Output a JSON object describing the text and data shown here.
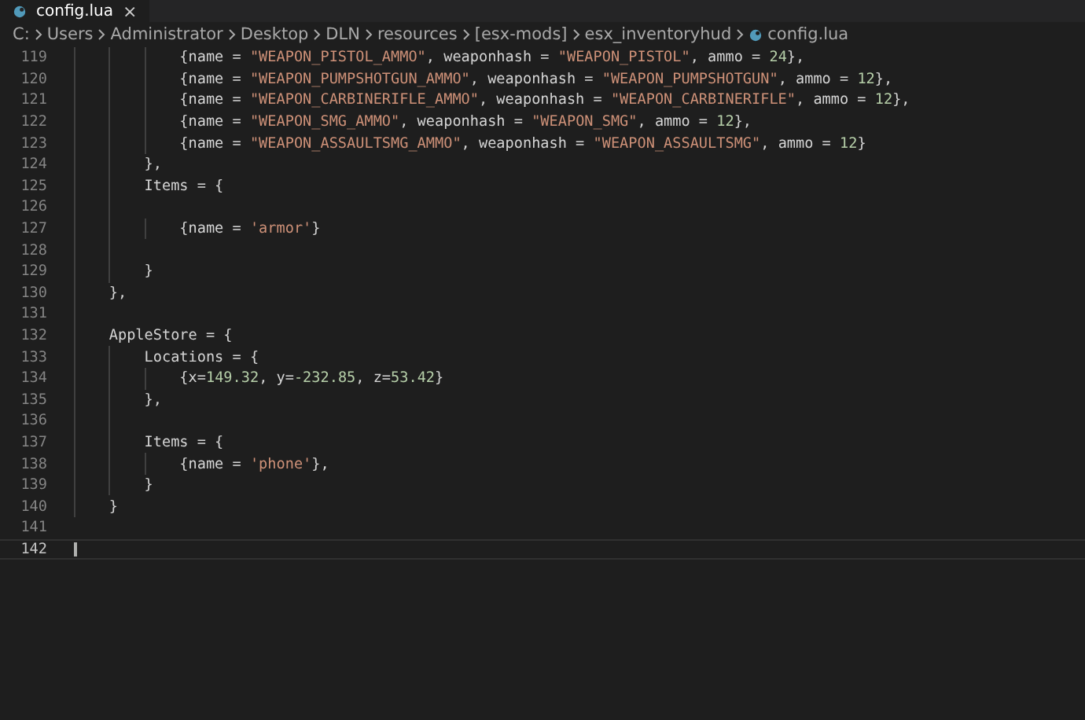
{
  "tab": {
    "title": "config.lua",
    "close": "×",
    "selected": true
  },
  "breadcrumb": [
    {
      "label": "C:",
      "kind": "folder"
    },
    {
      "label": "Users",
      "kind": "folder"
    },
    {
      "label": "Administrator",
      "kind": "folder"
    },
    {
      "label": "Desktop",
      "kind": "folder"
    },
    {
      "label": "DLN",
      "kind": "folder"
    },
    {
      "label": "resources",
      "kind": "folder"
    },
    {
      "label": "[esx-mods]",
      "kind": "folder"
    },
    {
      "label": "esx_inventoryhud",
      "kind": "folder"
    },
    {
      "label": "config.lua",
      "kind": "file"
    }
  ],
  "editor": {
    "lines": [
      {
        "number": "119",
        "active": false,
        "tokens": [
          {
            "kind": "plain",
            "text": "            {name = "
          },
          {
            "kind": "string",
            "text": "\"WEAPON_PISTOL_AMMO\""
          },
          {
            "kind": "plain",
            "text": ", weaponhash = "
          },
          {
            "kind": "string",
            "text": "\"WEAPON_PISTOL\""
          },
          {
            "kind": "plain",
            "text": ", ammo = "
          },
          {
            "kind": "number",
            "text": "24"
          },
          {
            "kind": "plain",
            "text": "},"
          }
        ]
      },
      {
        "number": "120",
        "active": false,
        "tokens": [
          {
            "kind": "plain",
            "text": "            {name = "
          },
          {
            "kind": "string",
            "text": "\"WEAPON_PUMPSHOTGUN_AMMO\""
          },
          {
            "kind": "plain",
            "text": ", weaponhash = "
          },
          {
            "kind": "string",
            "text": "\"WEAPON_PUMPSHOTGUN\""
          },
          {
            "kind": "plain",
            "text": ", ammo = "
          },
          {
            "kind": "number",
            "text": "12"
          },
          {
            "kind": "plain",
            "text": "},"
          }
        ]
      },
      {
        "number": "121",
        "active": false,
        "tokens": [
          {
            "kind": "plain",
            "text": "            {name = "
          },
          {
            "kind": "string",
            "text": "\"WEAPON_CARBINERIFLE_AMMO\""
          },
          {
            "kind": "plain",
            "text": ", weaponhash = "
          },
          {
            "kind": "string",
            "text": "\"WEAPON_CARBINERIFLE\""
          },
          {
            "kind": "plain",
            "text": ", ammo = "
          },
          {
            "kind": "number",
            "text": "12"
          },
          {
            "kind": "plain",
            "text": "},"
          }
        ]
      },
      {
        "number": "122",
        "active": false,
        "tokens": [
          {
            "kind": "plain",
            "text": "            {name = "
          },
          {
            "kind": "string",
            "text": "\"WEAPON_SMG_AMMO\""
          },
          {
            "kind": "plain",
            "text": ", weaponhash = "
          },
          {
            "kind": "string",
            "text": "\"WEAPON_SMG\""
          },
          {
            "kind": "plain",
            "text": ", ammo = "
          },
          {
            "kind": "number",
            "text": "12"
          },
          {
            "kind": "plain",
            "text": "},"
          }
        ]
      },
      {
        "number": "123",
        "active": false,
        "tokens": [
          {
            "kind": "plain",
            "text": "            {name = "
          },
          {
            "kind": "string",
            "text": "\"WEAPON_ASSAULTSMG_AMMO\""
          },
          {
            "kind": "plain",
            "text": ", weaponhash = "
          },
          {
            "kind": "string",
            "text": "\"WEAPON_ASSAULTSMG\""
          },
          {
            "kind": "plain",
            "text": ", ammo = "
          },
          {
            "kind": "number",
            "text": "12"
          },
          {
            "kind": "plain",
            "text": "}"
          }
        ]
      },
      {
        "number": "124",
        "active": false,
        "tokens": [
          {
            "kind": "plain",
            "text": "        },"
          }
        ]
      },
      {
        "number": "125",
        "active": false,
        "tokens": [
          {
            "kind": "plain",
            "text": "        Items = {"
          }
        ]
      },
      {
        "number": "126",
        "active": false
      },
      {
        "number": "127",
        "active": false,
        "tokens": [
          {
            "kind": "plain",
            "text": "            {name = "
          },
          {
            "kind": "string",
            "text": "'armor'"
          },
          {
            "kind": "plain",
            "text": "}"
          }
        ]
      },
      {
        "number": "128",
        "active": false
      },
      {
        "number": "129",
        "active": false,
        "tokens": [
          {
            "kind": "plain",
            "text": "        }"
          }
        ]
      },
      {
        "number": "130",
        "active": false,
        "tokens": [
          {
            "kind": "plain",
            "text": "    },"
          }
        ]
      },
      {
        "number": "131",
        "active": false
      },
      {
        "number": "132",
        "active": false,
        "tokens": [
          {
            "kind": "plain",
            "text": "    AppleStore = {"
          }
        ]
      },
      {
        "number": "133",
        "active": false,
        "tokens": [
          {
            "kind": "plain",
            "text": "        Locations = {"
          }
        ]
      },
      {
        "number": "134",
        "active": false,
        "tokens": [
          {
            "kind": "plain",
            "text": "            {x="
          },
          {
            "kind": "number",
            "text": "149.32"
          },
          {
            "kind": "plain",
            "text": ", y="
          },
          {
            "kind": "number",
            "text": "-232.85"
          },
          {
            "kind": "plain",
            "text": ", z="
          },
          {
            "kind": "number",
            "text": "53.42"
          },
          {
            "kind": "plain",
            "text": "}"
          }
        ]
      },
      {
        "number": "135",
        "active": false,
        "tokens": [
          {
            "kind": "plain",
            "text": "        },"
          }
        ]
      },
      {
        "number": "136",
        "active": false
      },
      {
        "number": "137",
        "active": false,
        "tokens": [
          {
            "kind": "plain",
            "text": "        Items = {"
          }
        ]
      },
      {
        "number": "138",
        "active": false,
        "tokens": [
          {
            "kind": "plain",
            "text": "            {name = "
          },
          {
            "kind": "string",
            "text": "'phone'"
          },
          {
            "kind": "plain",
            "text": "},"
          }
        ]
      },
      {
        "number": "139",
        "active": false,
        "tokens": [
          {
            "kind": "plain",
            "text": "        }"
          }
        ]
      },
      {
        "number": "140",
        "active": false,
        "tokens": [
          {
            "kind": "plain",
            "text": "    }"
          }
        ]
      },
      {
        "number": "141",
        "active": false
      },
      {
        "number": "142",
        "active": true
      }
    ]
  }
}
